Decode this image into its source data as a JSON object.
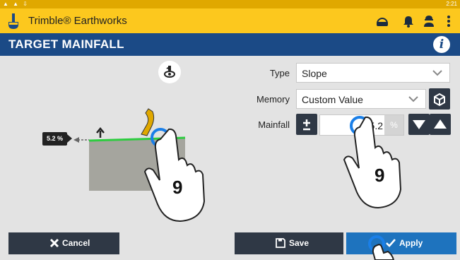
{
  "statusbar": {
    "left_icons": "▲ ▲ ⇩",
    "time": "2:21"
  },
  "app": {
    "title": "Trimble® Earthworks"
  },
  "appbar_icons": [
    "headset-icon",
    "bell-icon",
    "user-icon",
    "more-vert-icon"
  ],
  "header": {
    "title": "TARGET MAINFALL"
  },
  "illustration": {
    "slope_label": "5.2 %"
  },
  "form": {
    "type": {
      "label": "Type",
      "value": "Slope"
    },
    "memory": {
      "label": "Memory",
      "value": "Custom Value"
    },
    "mainfall": {
      "label": "Mainfall",
      "value": "5.2",
      "unit": "%"
    }
  },
  "buttons": {
    "cancel": "Cancel",
    "save": "Save",
    "apply": "Apply"
  },
  "gesture_hints": {
    "left": "9",
    "right": "9"
  },
  "colors": {
    "status": "#e0a800",
    "appbar": "#fcc81e",
    "header": "#1b4a86",
    "dark_button": "#2f3845",
    "apply": "#1e73be",
    "ground_line": "#2ecc40",
    "ground": "#a5a59e",
    "touch": "#1a7fe8"
  }
}
